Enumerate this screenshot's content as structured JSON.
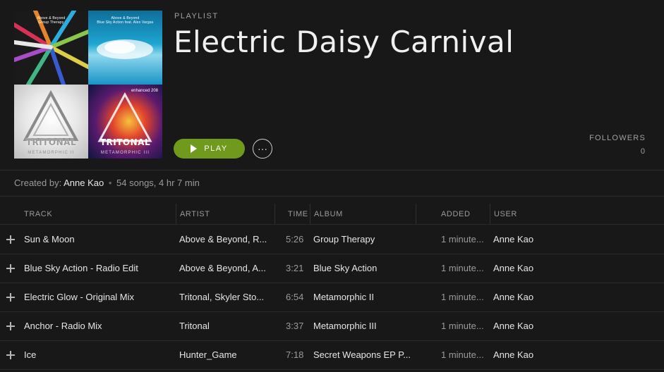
{
  "playlist": {
    "kind_label": "PLAYLIST",
    "title": "Electric Daisy Carnival",
    "play_label": "PLAY",
    "more_label": "···",
    "followers_label": "FOLLOWERS",
    "followers_count": "0",
    "created_by_label": "Created by:",
    "owner": "Anne Kao",
    "separator": "•",
    "summary": "54 songs, 4 hr 7 min"
  },
  "cover_art": {
    "tile_1": {
      "caption": "Above & Beyond",
      "sub": "Group Therapy"
    },
    "tile_2": {
      "caption": "Above & Beyond",
      "sub": "Blue Sky Action feat. Alex Vargas"
    },
    "tile_3": {
      "brand": "TRITONAL",
      "sub": "METAMORPHIC II"
    },
    "tile_4": {
      "brand": "TRITONAL",
      "sub": "METAMORPHIC III",
      "tag": "enhanced 208"
    }
  },
  "colors": {
    "background": "#181818",
    "accent_green": "#6f9a1b",
    "muted_text": "#9a9a9a"
  },
  "table": {
    "columns": [
      "TRACK",
      "ARTIST",
      "TIME",
      "ALBUM",
      "ADDED",
      "USER"
    ],
    "rows": [
      {
        "track": "Sun & Moon",
        "artist": "Above & Beyond, R...",
        "time": "5:26",
        "album": "Group Therapy",
        "added": "1 minute...",
        "user": "Anne Kao"
      },
      {
        "track": "Blue Sky Action - Radio Edit",
        "artist": "Above & Beyond, A...",
        "time": "3:21",
        "album": "Blue Sky Action",
        "added": "1 minute...",
        "user": "Anne Kao"
      },
      {
        "track": "Electric Glow - Original Mix",
        "artist": "Tritonal, Skyler Sto...",
        "time": "6:54",
        "album": "Metamorphic II",
        "added": "1 minute...",
        "user": "Anne Kao"
      },
      {
        "track": "Anchor - Radio Mix",
        "artist": "Tritonal",
        "time": "3:37",
        "album": "Metamorphic III",
        "added": "1 minute...",
        "user": "Anne Kao"
      },
      {
        "track": "Ice",
        "artist": "Hunter_Game",
        "time": "7:18",
        "album": "Secret Weapons EP P...",
        "added": "1 minute...",
        "user": "Anne Kao"
      }
    ]
  }
}
